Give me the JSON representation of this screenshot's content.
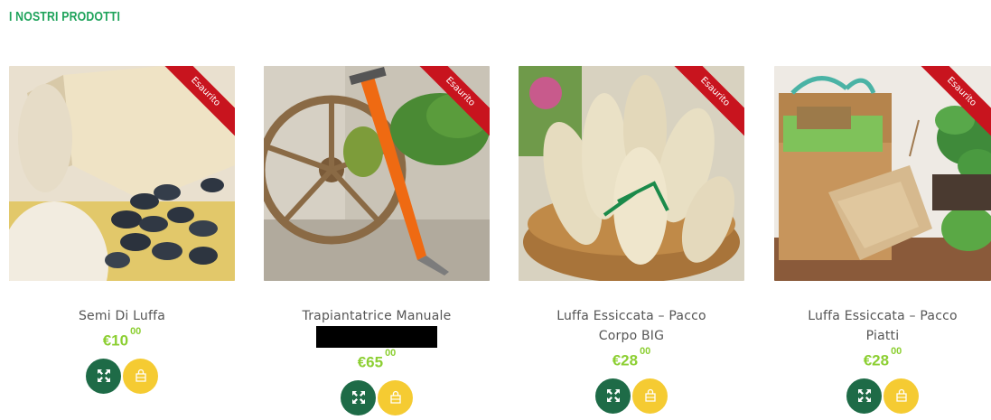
{
  "section": {
    "title": "I NOSTRI PRODOTTI"
  },
  "colors": {
    "title_green": "#1fa35b",
    "price_green": "#8ccf32",
    "expand_btn": "#1e6b47",
    "cart_btn": "#f5cb32",
    "ribbon_red": "#c8141e"
  },
  "products": [
    {
      "ribbon": "Esaurito",
      "name_line1": "Semi Di Luffa",
      "name_line2": "",
      "price_main": "€10",
      "price_cents": "00",
      "icons": {
        "expand": "expand-arrows-icon",
        "cart": "shopping-bag-icon"
      }
    },
    {
      "ribbon": "Esaurito",
      "name_line1": "Trapiantatrice Manuale",
      "name_line2": "",
      "price_main": "€65",
      "price_cents": "00",
      "icons": {
        "expand": "expand-arrows-icon",
        "cart": "shopping-bag-icon"
      }
    },
    {
      "ribbon": "Esaurito",
      "name_line1": "Luffa Essiccata – Pacco",
      "name_line2": "Corpo BIG",
      "price_main": "€28",
      "price_cents": "00",
      "icons": {
        "expand": "expand-arrows-icon",
        "cart": "shopping-bag-icon"
      }
    },
    {
      "ribbon": "Esaurito",
      "name_line1": "Luffa Essiccata – Pacco",
      "name_line2": "Piatti",
      "price_main": "€28",
      "price_cents": "00",
      "icons": {
        "expand": "expand-arrows-icon",
        "cart": "shopping-bag-icon"
      }
    }
  ]
}
